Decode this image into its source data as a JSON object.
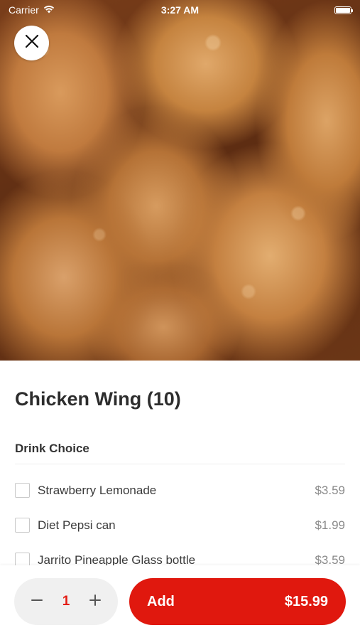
{
  "status_bar": {
    "carrier": "Carrier",
    "time": "3:27 AM"
  },
  "hero": {
    "image_icon": "food-photo"
  },
  "item": {
    "title": "Chicken Wing (10)"
  },
  "section": {
    "title": "Drink Choice",
    "options": [
      {
        "label": "Strawberry Lemonade",
        "price": "$3.59",
        "checked": false
      },
      {
        "label": "Diet Pepsi can",
        "price": "$1.99",
        "checked": false
      },
      {
        "label": "Jarrito Pineapple Glass bottle",
        "price": "$3.59",
        "checked": false
      }
    ]
  },
  "footer": {
    "quantity": "1",
    "add_label": "Add",
    "total": "$15.99"
  },
  "colors": {
    "accent": "#e0180e",
    "quantity_text": "#e31c13",
    "stepper_bg": "#f0f0f0"
  }
}
